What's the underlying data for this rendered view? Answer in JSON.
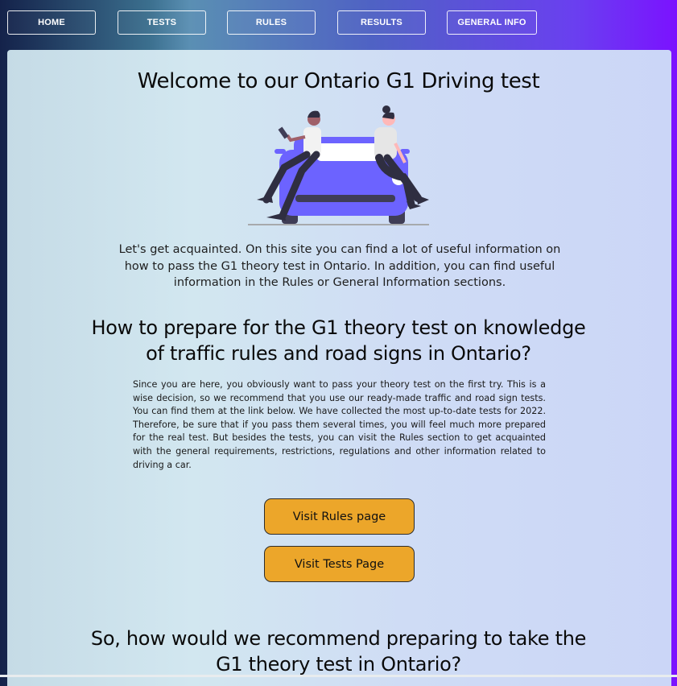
{
  "nav": {
    "items": [
      {
        "label": "HOME"
      },
      {
        "label": "TESTS"
      },
      {
        "label": "RULES"
      },
      {
        "label": "RESULTS"
      },
      {
        "label": "GENERAL INFO"
      }
    ]
  },
  "main": {
    "title": "Welcome to our Ontario G1 Driving test",
    "intro": "Let's get acquainted. On this site you can find a lot of useful information on how to pass the G1 theory test in Ontario. In addition, you can find useful information in the Rules or General Information sections.",
    "prepare_heading": "How to prepare for the G1 theory test on knowledge of traffic rules and road signs in Ontario?",
    "prepare_text": "Since you are here, you obviously want to pass your theory test on the first try. This is a wise decision, so we recommend that you use our ready-made traffic and road sign tests. You can find them at the link below. We have collected the most up-to-date tests for 2022. Therefore, be sure that if you pass them several times, you will feel much more prepared for the real test. But besides the tests, you can visit the Rules section to get acquainted with the general requirements, restrictions, regulations and other information related to driving a car.",
    "rules_button": "Visit Rules page",
    "tests_button": "Visit Tests Page",
    "recommend_heading": "So, how would we recommend preparing to take the G1 theory test in Ontario?"
  },
  "colors": {
    "button_bg": "#eca62a",
    "car": "#6c63ff",
    "nav_gradient_end": "#7b12ff"
  },
  "illustration": {
    "name": "people-with-car-illustration"
  }
}
